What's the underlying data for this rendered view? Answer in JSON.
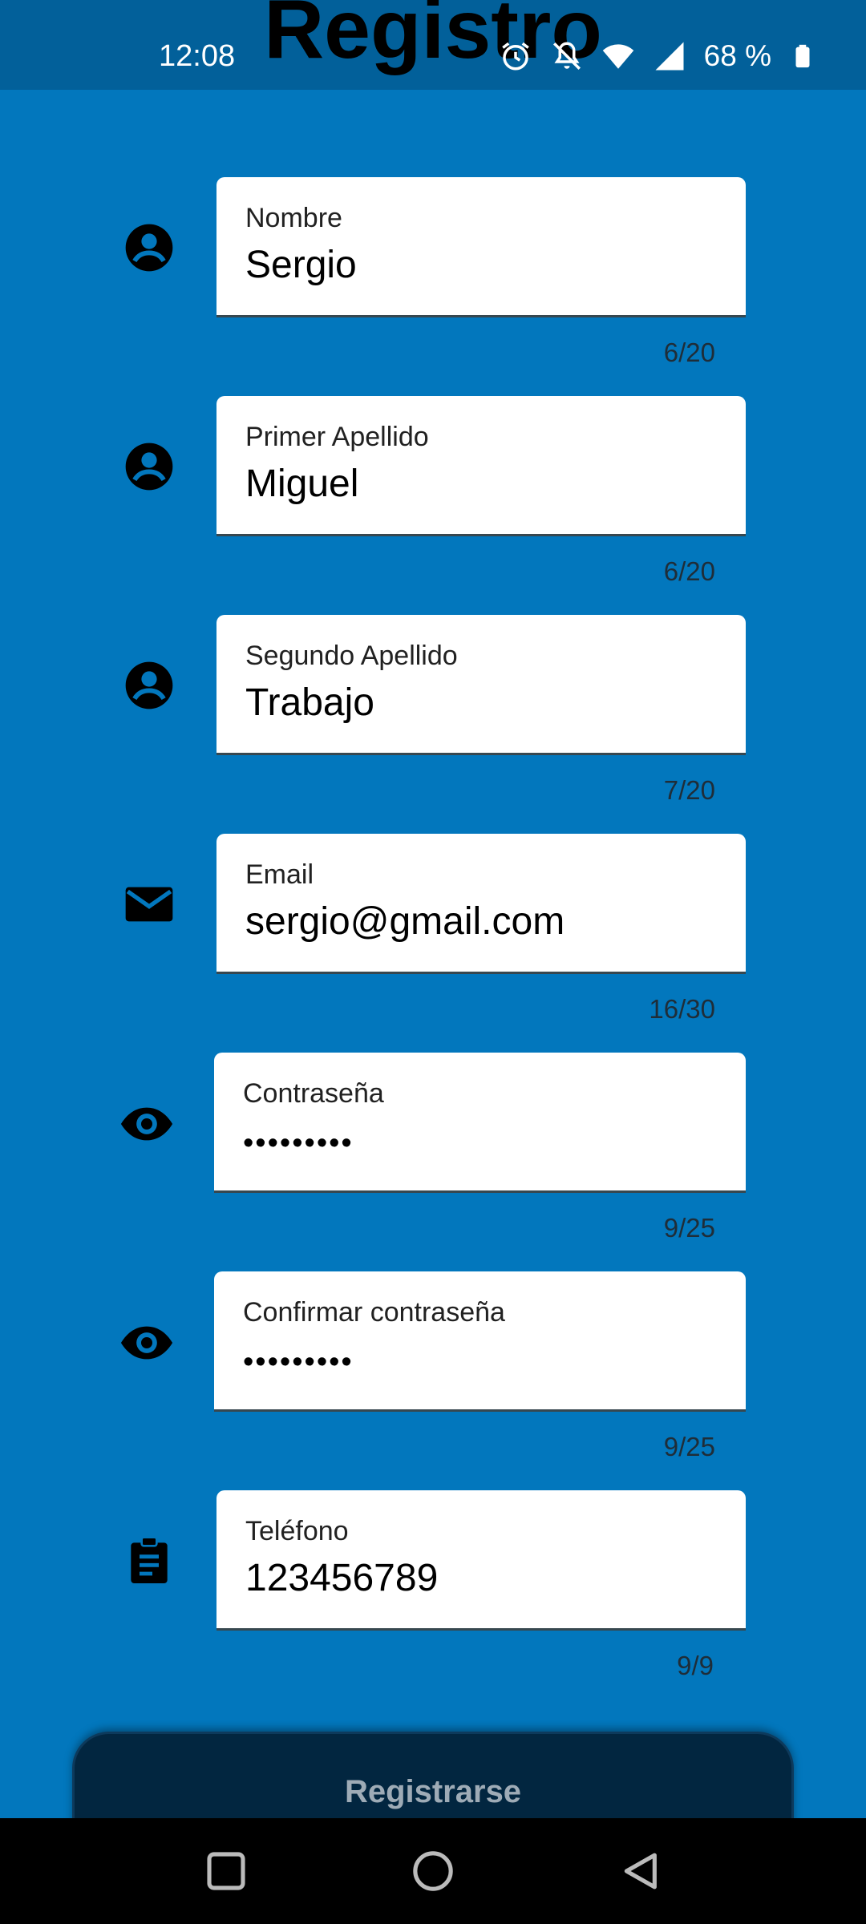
{
  "header": {
    "title": "Registro"
  },
  "status_bar": {
    "time": "12:08",
    "battery_text": "68 %",
    "icons": [
      "alarm-icon",
      "notifications-off-icon",
      "wifi-icon",
      "signal-icon",
      "battery-icon"
    ]
  },
  "form": {
    "fields": [
      {
        "label": "Nombre",
        "value": "Sergio",
        "counter": "6/20",
        "icon": "person-icon"
      },
      {
        "label": "Primer Apellido",
        "value": "Miguel",
        "counter": "6/20",
        "icon": "person-icon"
      },
      {
        "label": "Segundo Apellido",
        "value": "Trabajo",
        "counter": "7/20",
        "icon": "person-icon"
      },
      {
        "label": "Email",
        "value": "sergio@gmail.com",
        "counter": "16/30",
        "icon": "mail-icon"
      },
      {
        "label": "Contraseña",
        "value": "•••••••••",
        "counter": "9/25",
        "icon": "eye-icon"
      },
      {
        "label": "Confirmar contraseña",
        "value": "•••••••••",
        "counter": "9/25",
        "icon": "eye-icon"
      },
      {
        "label": "Teléfono",
        "value": "123456789",
        "counter": "9/9",
        "icon": "clipboard-icon"
      }
    ],
    "submit_label": "Registrarse"
  },
  "nav_bar": {
    "icons": [
      "recent-apps-icon",
      "home-icon",
      "back-icon"
    ]
  },
  "colors": {
    "background": "#0277BD",
    "status_bar": "#02609A",
    "button": "#022640",
    "field": "#FFFFFF"
  }
}
